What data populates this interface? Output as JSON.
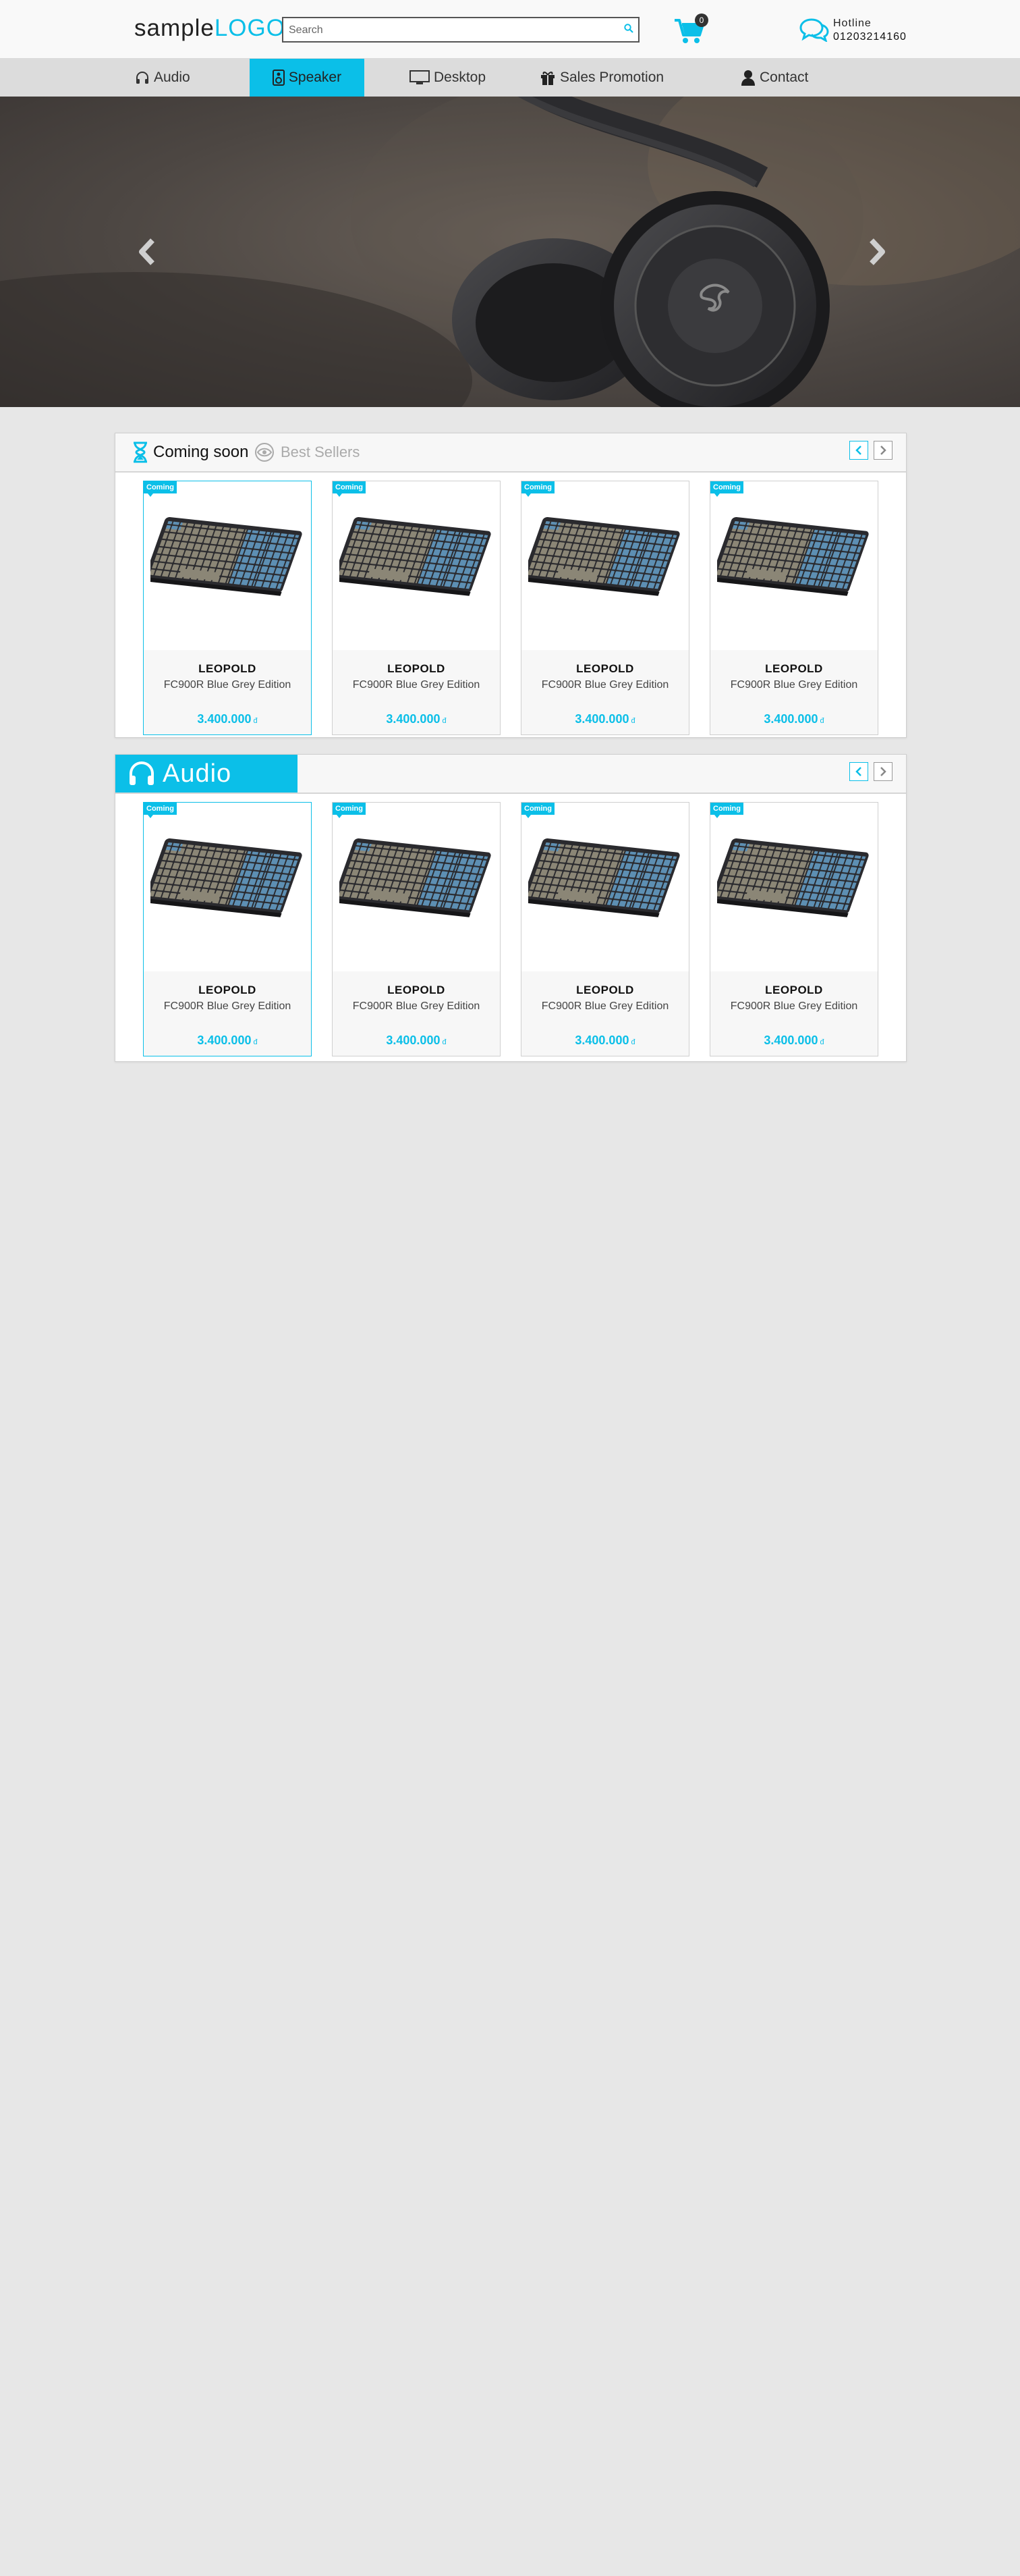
{
  "header": {
    "logo_main": "sample",
    "logo_accent": "LOGO",
    "search_placeholder": "Search",
    "cart_count": "0",
    "hotline_label": "Hotline",
    "hotline_number": "01203214160"
  },
  "nav": {
    "items": [
      {
        "label": "Audio",
        "icon": "headphones-icon"
      },
      {
        "label": "Speaker",
        "icon": "speaker-icon",
        "active": true
      },
      {
        "label": "Desktop",
        "icon": "monitor-icon"
      },
      {
        "label": "Sales Promotion",
        "icon": "gift-icon"
      },
      {
        "label": "Contact",
        "icon": "user-icon"
      }
    ]
  },
  "section1": {
    "tab_active": "Coming soon",
    "tab_inactive": "Best Sellers",
    "products": [
      {
        "badge": "Coming",
        "brand": "LEOPOLD",
        "model": "FC900R Blue Grey Edition",
        "price": "3.400.000",
        "currency": "đ"
      },
      {
        "badge": "Coming",
        "brand": "LEOPOLD",
        "model": "FC900R Blue Grey Edition",
        "price": "3.400.000",
        "currency": "đ"
      },
      {
        "badge": "Coming",
        "brand": "LEOPOLD",
        "model": "FC900R Blue Grey Edition",
        "price": "3.400.000",
        "currency": "đ"
      },
      {
        "badge": "Coming",
        "brand": "LEOPOLD",
        "model": "FC900R Blue Grey Edition",
        "price": "3.400.000",
        "currency": "đ"
      }
    ]
  },
  "section2": {
    "title": "Audio",
    "products": [
      {
        "badge": "Coming",
        "brand": "LEOPOLD",
        "model": "FC900R Blue Grey Edition",
        "price": "3.400.000",
        "currency": "đ"
      },
      {
        "badge": "Coming",
        "brand": "LEOPOLD",
        "model": "FC900R Blue Grey Edition",
        "price": "3.400.000",
        "currency": "đ"
      },
      {
        "badge": "Coming",
        "brand": "LEOPOLD",
        "model": "FC900R Blue Grey Edition",
        "price": "3.400.000",
        "currency": "đ"
      },
      {
        "badge": "Coming",
        "brand": "LEOPOLD",
        "model": "FC900R Blue Grey Edition",
        "price": "3.400.000",
        "currency": "đ"
      }
    ]
  },
  "colors": {
    "accent": "#0bbfe8",
    "background": "#e7e7e7",
    "nav_background": "#dcdcdc"
  }
}
